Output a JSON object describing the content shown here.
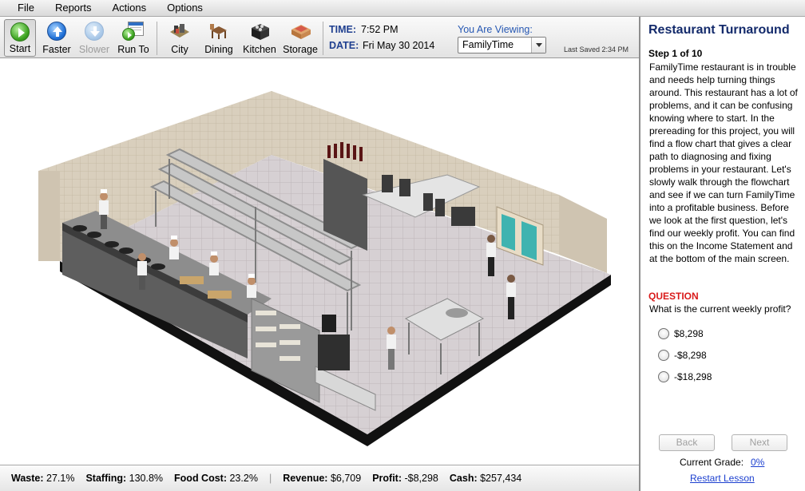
{
  "menu": {
    "items": [
      {
        "label": "File"
      },
      {
        "label": "Reports"
      },
      {
        "label": "Actions"
      },
      {
        "label": "Options"
      }
    ]
  },
  "toolbar": {
    "start_label": "Start",
    "faster_label": "Faster",
    "slower_label": "Slower",
    "run_to_label": "Run To",
    "city_label": "City",
    "dining_label": "Dining",
    "kitchen_label": "Kitchen",
    "storage_label": "Storage",
    "time_label": "TIME:",
    "time_value": "7:52 PM",
    "date_label": "DATE:",
    "date_value": "Fri May 30 2014",
    "viewing_label": "You Are Viewing:",
    "viewing_value": "FamilyTime",
    "last_saved": "Last Saved 2:34 PM"
  },
  "icons": {
    "start": "play-icon",
    "faster": "up-arrow-icon",
    "slower": "down-arrow-icon",
    "run_to": "run-to-icon",
    "city": "city-icon",
    "dining": "dining-icon",
    "kitchen": "kitchen-icon",
    "storage": "storage-icon"
  },
  "status": {
    "waste_label": "Waste:",
    "waste_value": "27.1%",
    "staffing_label": "Staffing:",
    "staffing_value": "130.8%",
    "food_cost_label": "Food Cost:",
    "food_cost_value": "23.2%",
    "separator": "|",
    "revenue_label": "Revenue:",
    "revenue_value": "$6,709",
    "profit_label": "Profit:",
    "profit_value": "-$8,298",
    "cash_label": "Cash:",
    "cash_value": "$257,434"
  },
  "lesson": {
    "title": "Restaurant Turnaround",
    "step": "Step 1 of 10",
    "text": "FamilyTime restaurant is in trouble and needs help turning things around. This restaurant has a lot of problems, and it can be confusing knowing where to start. In the prereading for this project, you will find a flow chart that gives a clear path to diagnosing and fixing problems in your restaurant. Let's slowly walk through the flowchart and see if we can turn FamilyTime into a profitable business. Before we look at the first question, let's find our weekly profit. You can find this on the Income Statement and at the bottom of the main screen.",
    "question_label": "QUESTION",
    "question": "What is the current weekly profit?",
    "answers": [
      {
        "label": "$8,298"
      },
      {
        "label": "-$8,298"
      },
      {
        "label": "-$18,298"
      }
    ],
    "back_label": "Back",
    "next_label": "Next",
    "grade_label": "Current Grade:",
    "grade_value": "0%",
    "restart_label": "Restart Lesson"
  },
  "colors": {
    "title_blue": "#132a6b",
    "label_blue": "#1f3f8f",
    "question_red": "#d91a1a",
    "link_blue": "#1b3fcf",
    "floor": "#c9c3c7",
    "wall": "#d8ccb8"
  }
}
